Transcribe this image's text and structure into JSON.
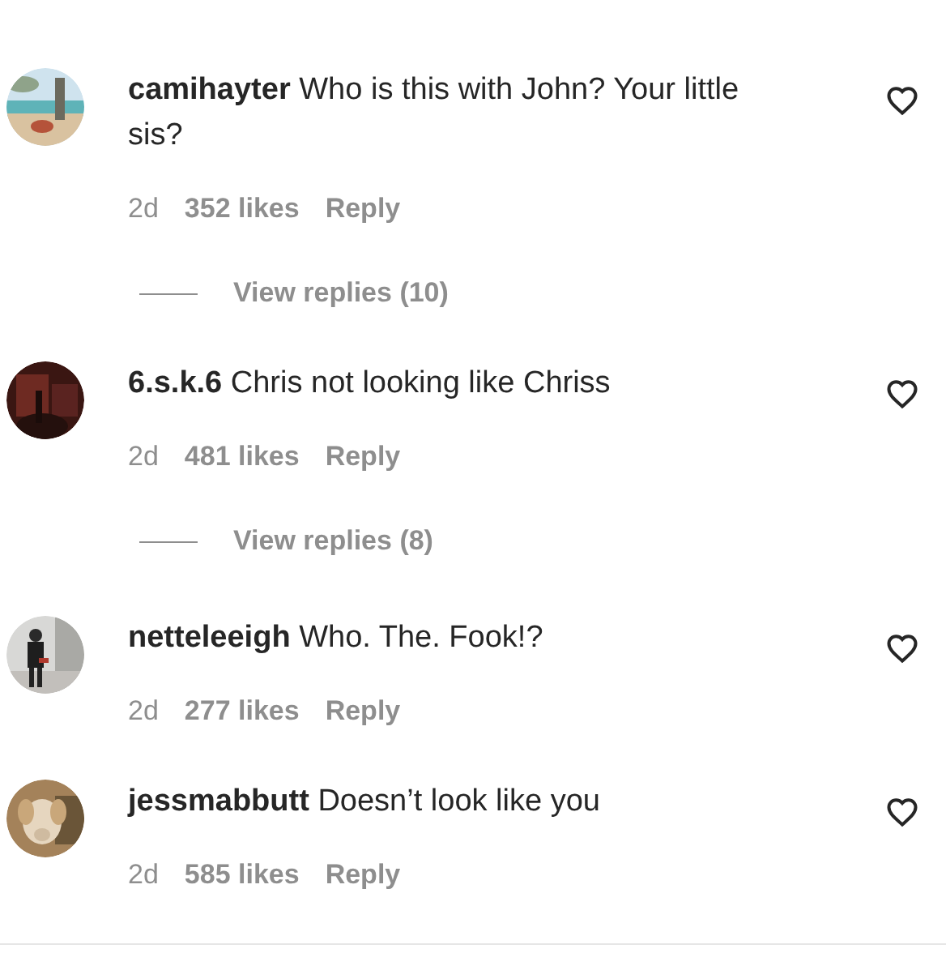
{
  "comments": [
    {
      "username": "camihayter",
      "text": "Who is this with John? Your little sis?",
      "time": "2d",
      "likes": "352 likes",
      "reply": "Reply",
      "view_replies": "View replies (10)"
    },
    {
      "username": "6.s.k.6",
      "text": "Chris not looking like Chriss",
      "time": "2d",
      "likes": "481 likes",
      "reply": "Reply",
      "view_replies": "View replies (8)"
    },
    {
      "username": "netteleeigh",
      "text": "Who. The. Fook!?",
      "time": "2d",
      "likes": "277 likes",
      "reply": "Reply"
    },
    {
      "username": "jessmabbutt",
      "text": "Doesn’t look like you",
      "time": "2d",
      "likes": "585 likes",
      "reply": "Reply"
    }
  ]
}
